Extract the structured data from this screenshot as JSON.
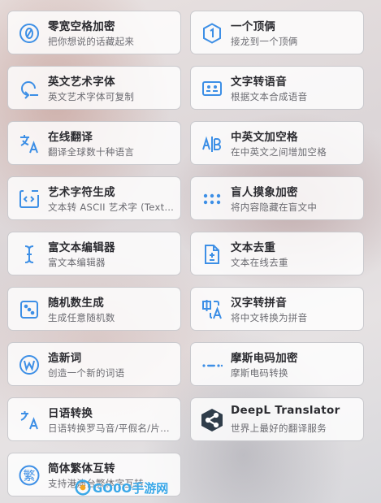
{
  "cards": [
    {
      "title": "零宽空格加密",
      "desc": "把你想说的话藏起来",
      "icon": "zero-slash-icon"
    },
    {
      "title": "一个顶俩",
      "desc": "接龙到一个顶俩",
      "icon": "hexagon-one-icon"
    },
    {
      "title": "英文艺术字体",
      "desc": "英文艺术字体可复制",
      "icon": "rotate-arrow-icon"
    },
    {
      "title": "文字转语音",
      "desc": "根据文本合成语音",
      "icon": "subtitles-icon"
    },
    {
      "title": "在线翻译",
      "desc": "翻译全球数十种语言",
      "icon": "translate-icon"
    },
    {
      "title": "中英文加空格",
      "desc": "在中英文之间增加空格",
      "icon": "ab-split-icon"
    },
    {
      "title": "艺术字符生成",
      "desc": "文本转 ASCII 艺术字 (Text ASCII Art)",
      "icon": "code-box-icon"
    },
    {
      "title": "盲人摸象加密",
      "desc": "将内容隐藏在盲文中",
      "icon": "braille-dots-icon"
    },
    {
      "title": "富文本编辑器",
      "desc": "富文本编辑器",
      "icon": "text-cursor-icon"
    },
    {
      "title": "文本去重",
      "desc": "文本在线去重",
      "icon": "file-plus-minus-icon"
    },
    {
      "title": "随机数生成",
      "desc": "生成任意随机数",
      "icon": "dice-icon"
    },
    {
      "title": "汉字转拼音",
      "desc": "将中文转换为拼音",
      "icon": "chinese-letter-icon"
    },
    {
      "title": "造新词",
      "desc": "创造一个新的词语",
      "icon": "w-circle-icon"
    },
    {
      "title": "摩斯电码加密",
      "desc": "摩斯电码转换",
      "icon": "morse-dash-icon"
    },
    {
      "title": "日语转换",
      "desc": "日语转换罗马音/平假名/片假名",
      "icon": "japanese-translate-icon"
    },
    {
      "title": "DeepL Translator",
      "desc": "世界上最好的翻译服务",
      "icon": "deepl-logo-icon"
    },
    {
      "title": "简体繁体互转",
      "desc": "支持港澳台繁体字互转",
      "icon": "fan-character-icon"
    }
  ],
  "icon_glyphs": {
    "fan": "繁"
  },
  "watermark": {
    "text": "GO0O手游网",
    "subtext": "WWW.GO0GO.CN"
  },
  "colors": {
    "accent": "#3d8fe6",
    "deepl_badge": "#2f3d4a"
  }
}
